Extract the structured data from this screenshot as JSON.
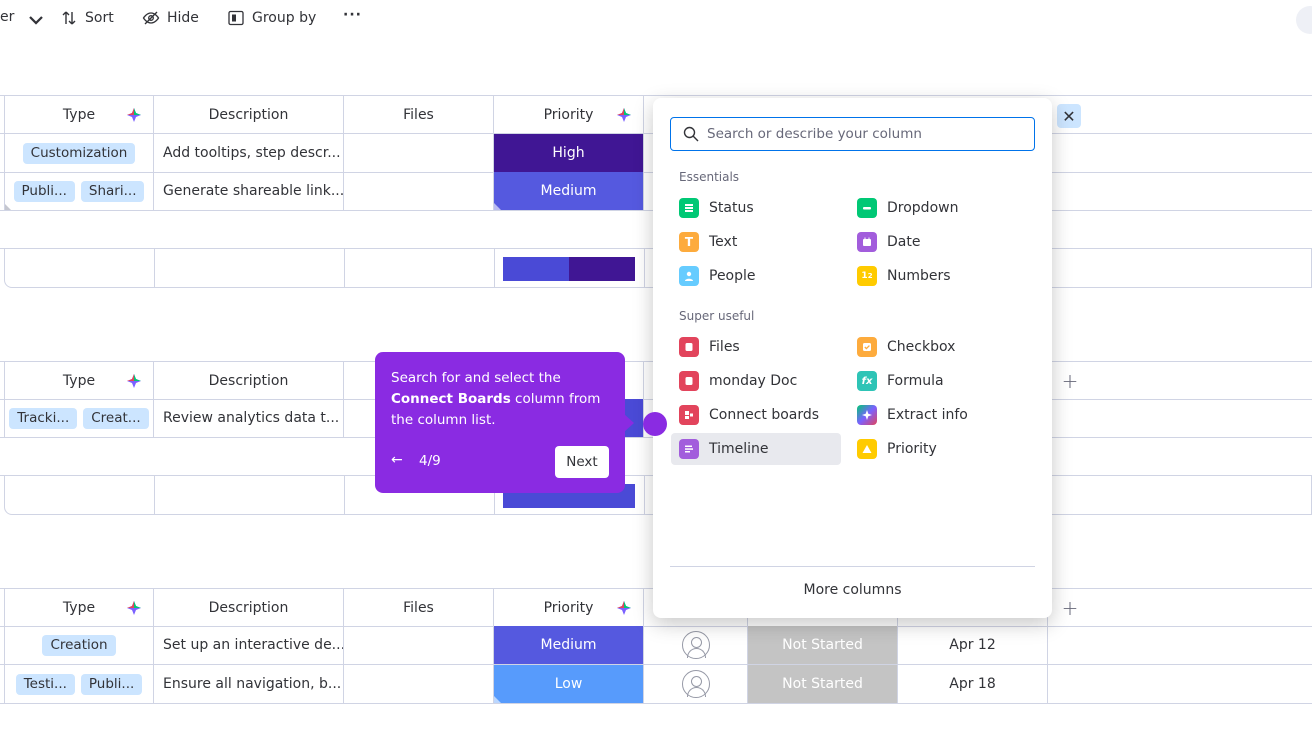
{
  "toolbar": {
    "filter_partial": "er",
    "sort": "Sort",
    "hide": "Hide",
    "group_by": "Group by",
    "more": "···"
  },
  "columns": {
    "type": "Type",
    "description": "Description",
    "files": "Files",
    "priority": "Priority"
  },
  "group1": {
    "rows": [
      {
        "tags": [
          "Customization"
        ],
        "description": "Add tooltips, step descr...",
        "priority": "High"
      },
      {
        "tags": [
          "Publi...",
          "Shari..."
        ],
        "description": "Generate shareable link...",
        "priority": "Medium"
      }
    ],
    "summary_colors": [
      "#4a4ad6",
      "#401694"
    ],
    "summary_shares": [
      0.5,
      0.5
    ]
  },
  "group2": {
    "rows": [
      {
        "tags": [
          "Tracki...",
          "Creat..."
        ],
        "description": "Review analytics data t...",
        "priority": ""
      }
    ]
  },
  "group3": {
    "rows": [
      {
        "tags": [
          "Creation"
        ],
        "description": "Set up an interactive de...",
        "priority": "Medium",
        "status": "Not Started",
        "date": "Apr 12"
      },
      {
        "tags": [
          "Testi...",
          "Publi..."
        ],
        "description": "Ensure all navigation, b...",
        "priority": "Low",
        "status": "Not Started",
        "date": "Apr 18"
      }
    ]
  },
  "panel": {
    "search_placeholder": "Search or describe your column",
    "essentials_title": "Essentials",
    "super_useful_title": "Super useful",
    "essentials": [
      {
        "label": "Status",
        "icon": "status-icon",
        "color": "#00c875"
      },
      {
        "label": "Dropdown",
        "icon": "dropdown-icon",
        "color": "#00c875"
      },
      {
        "label": "Text",
        "icon": "text-icon",
        "color": "#fdab3d"
      },
      {
        "label": "Date",
        "icon": "date-icon",
        "color": "#a25ddc"
      },
      {
        "label": "People",
        "icon": "people-icon",
        "color": "#66ccff"
      },
      {
        "label": "Numbers",
        "icon": "numbers-icon",
        "color": "#ffcb00"
      }
    ],
    "super_useful": [
      {
        "label": "Files",
        "icon": "files-icon",
        "color": "#e2445c"
      },
      {
        "label": "Checkbox",
        "icon": "checkbox-icon",
        "color": "#fdab3d"
      },
      {
        "label": "monday Doc",
        "icon": "doc-icon",
        "color": "#e2445c"
      },
      {
        "label": "Formula",
        "icon": "formula-icon",
        "color": "#2ec4b6"
      },
      {
        "label": "Connect boards",
        "icon": "connect-boards-icon",
        "color": "#e2445c"
      },
      {
        "label": "Extract info",
        "icon": "extract-info-icon",
        "color": "#7b61ff"
      },
      {
        "label": "Timeline",
        "icon": "timeline-icon",
        "color": "#a25ddc"
      },
      {
        "label": "Priority",
        "icon": "priority-icon",
        "color": "#ffcb00"
      }
    ],
    "more_columns": "More columns",
    "close": "✕"
  },
  "tour": {
    "text_before": "Search for and select the ",
    "text_bold": "Connect Boards",
    "text_after": " column from the column list.",
    "back": "←",
    "step": "4/9",
    "next": "Next"
  },
  "add_column": "+"
}
